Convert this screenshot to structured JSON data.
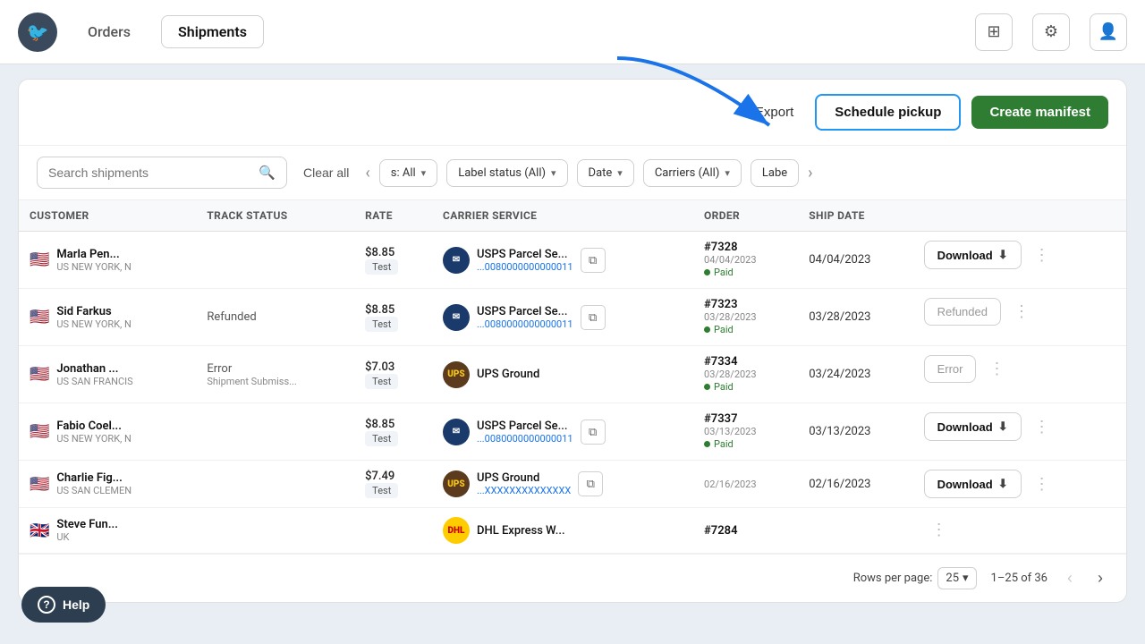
{
  "nav": {
    "logo_text": "🐦",
    "tabs": [
      {
        "label": "Orders",
        "active": false
      },
      {
        "label": "Shipments",
        "active": true
      }
    ],
    "icons": [
      "chart-icon",
      "settings-icon",
      "user-icon"
    ]
  },
  "toolbar": {
    "export_label": "Export",
    "schedule_pickup_label": "Schedule pickup",
    "create_manifest_label": "Create manifest"
  },
  "filters": {
    "search_placeholder": "Search shipments",
    "clear_all_label": "Clear all",
    "dropdowns": [
      {
        "label": "s: All"
      },
      {
        "label": "Label status (All)"
      },
      {
        "label": "Date"
      },
      {
        "label": "Carriers (All)"
      },
      {
        "label": "Labe"
      }
    ]
  },
  "table": {
    "columns": [
      "CUSTOMER",
      "TRACK STATUS",
      "RATE",
      "CARRIER SERVICE",
      "ORDER",
      "SHIP DATE",
      ""
    ],
    "rows": [
      {
        "flag": "🇺🇸",
        "country": "US",
        "customer_name": "Marla Pen...",
        "customer_sub": "NEW YORK, N",
        "track_status": "",
        "track_sub": "",
        "rate": "$8.85",
        "test": "Test",
        "carrier_type": "usps",
        "carrier_label": "USPS",
        "carrier_name": "USPS Parcel Se...",
        "carrier_tracking": "...0080000000000011",
        "order_num": "#7328",
        "order_date": "04/04/2023",
        "paid": "Paid",
        "ship_date": "04/04/2023",
        "action": "Download"
      },
      {
        "flag": "🇺🇸",
        "country": "US",
        "customer_name": "Sid Farkus",
        "customer_sub": "NEW YORK, N",
        "track_status": "Refunded",
        "track_sub": "",
        "rate": "$8.85",
        "test": "Test",
        "carrier_type": "usps",
        "carrier_label": "USPS",
        "carrier_name": "USPS Parcel Se...",
        "carrier_tracking": "...0080000000000011",
        "order_num": "#7323",
        "order_date": "03/28/2023",
        "paid": "Paid",
        "ship_date": "03/28/2023",
        "action": "Refunded"
      },
      {
        "flag": "🇺🇸",
        "country": "US",
        "customer_name": "Jonathan ...",
        "customer_sub": "SAN FRANCIS",
        "track_status": "Error",
        "track_sub": "Shipment Submiss...",
        "rate": "$7.03",
        "test": "Test",
        "carrier_type": "ups",
        "carrier_label": "UPS",
        "carrier_name": "UPS Ground",
        "carrier_tracking": "",
        "order_num": "#7334",
        "order_date": "03/28/2023",
        "paid": "Paid",
        "ship_date": "03/24/2023",
        "action": "Error"
      },
      {
        "flag": "🇺🇸",
        "country": "US",
        "customer_name": "Fabio Coel...",
        "customer_sub": "NEW YORK, N",
        "track_status": "",
        "track_sub": "",
        "rate": "$8.85",
        "test": "Test",
        "carrier_type": "usps",
        "carrier_label": "USPS",
        "carrier_name": "USPS Parcel Se...",
        "carrier_tracking": "...0080000000000011",
        "order_num": "#7337",
        "order_date": "03/13/2023",
        "paid": "Paid",
        "ship_date": "03/13/2023",
        "action": "Download"
      },
      {
        "flag": "🇺🇸",
        "country": "US",
        "customer_name": "Charlie Fig...",
        "customer_sub": "SAN CLEMEN",
        "track_status": "",
        "track_sub": "",
        "rate": "$7.49",
        "test": "Test",
        "carrier_type": "ups",
        "carrier_label": "UPS",
        "carrier_name": "UPS Ground",
        "carrier_tracking": "...XXXXXXXXXXXXXX",
        "order_num": "",
        "order_date": "02/16/2023",
        "paid": "",
        "ship_date": "02/16/2023",
        "action": "Download"
      },
      {
        "flag": "🇬🇧",
        "country": "UK",
        "customer_name": "Steve Fun...",
        "customer_sub": "",
        "track_status": "",
        "track_sub": "",
        "rate": "",
        "test": "",
        "carrier_type": "dhl",
        "carrier_label": "DHL",
        "carrier_name": "DHL Express W...",
        "carrier_tracking": "",
        "order_num": "#7284",
        "order_date": "",
        "paid": "",
        "ship_date": "",
        "action": ""
      }
    ]
  },
  "footer": {
    "rows_per_page_label": "Rows per page:",
    "rows_per_page_value": "25",
    "pagination_info": "1–25 of 36"
  },
  "help": {
    "label": "Help"
  }
}
